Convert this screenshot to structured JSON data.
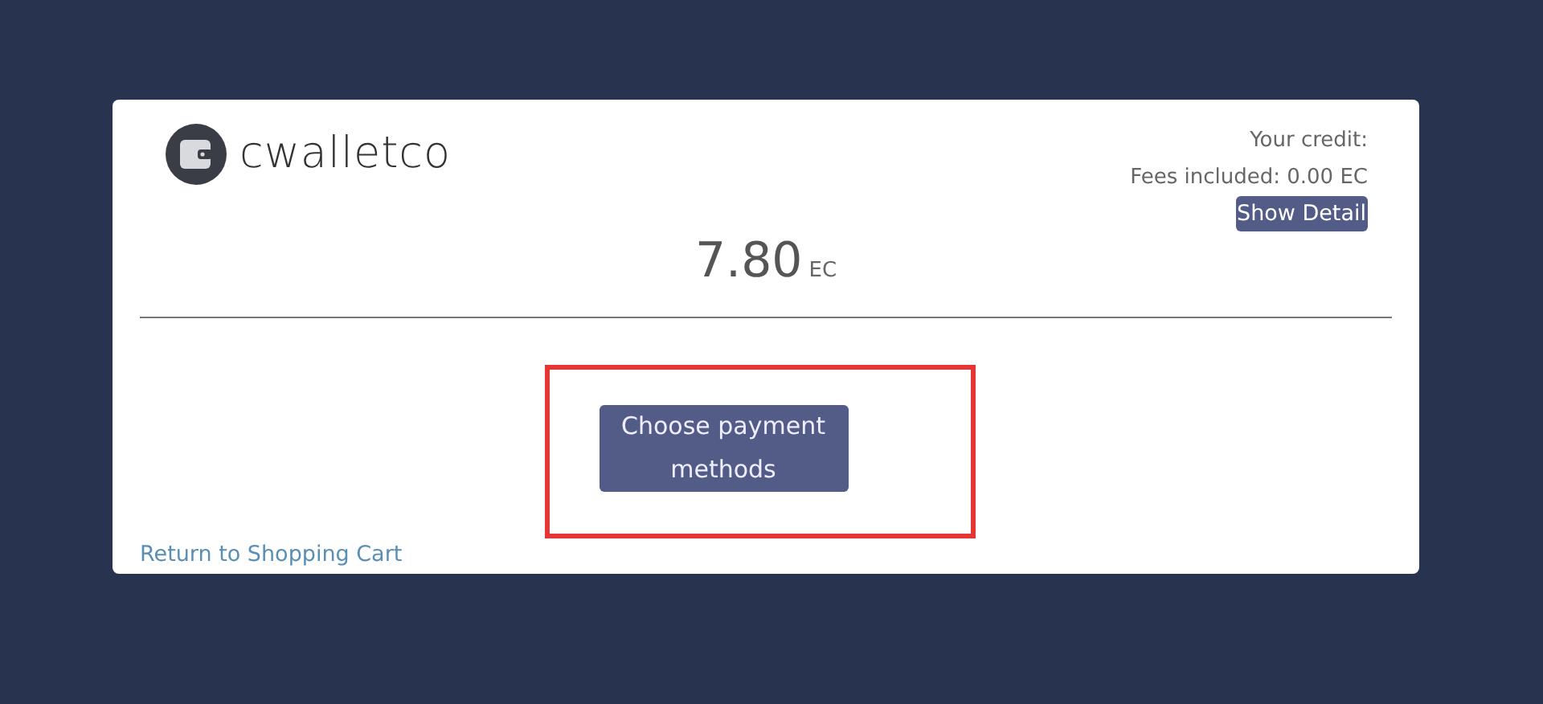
{
  "brand": {
    "name": "cwalletco"
  },
  "credit": {
    "label": "Your credit:",
    "fees": "Fees included: 0.00 EC",
    "detail_button": "Show Detail"
  },
  "amount": {
    "value": "7.80",
    "currency": "EC"
  },
  "payment_button": {
    "label": "Choose payment methods",
    "highlighted": true
  },
  "return_link": "Return to Shopping Cart"
}
